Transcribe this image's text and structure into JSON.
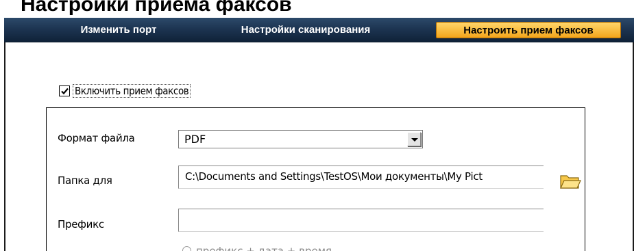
{
  "window": {
    "title_partial": "Настройки приема факсов"
  },
  "tabs": [
    {
      "label": "Изменить порт",
      "active": false
    },
    {
      "label": "Настройки сканирования",
      "active": false
    },
    {
      "label": "Настроить прием факсов",
      "active": true
    }
  ],
  "enable_fax": {
    "label": "Включить прием факсов",
    "checked": true
  },
  "form": {
    "file_format": {
      "label": "Формат файла",
      "value": "PDF"
    },
    "folder": {
      "label": "Папка для",
      "value": "C:\\Documents and Settings\\TestOS\\Мои документы\\My Pict"
    },
    "prefix": {
      "label": "Префикс",
      "value": ""
    },
    "prefix_option": {
      "label": "префикс + дата + время"
    }
  },
  "icons": {
    "folder": "folder-icon",
    "checkbox_check": "check-icon",
    "dropdown_arrow": "chevron-down-icon"
  },
  "colors": {
    "tabbar": "#1d3552",
    "active_tab": "#f3a51b"
  }
}
